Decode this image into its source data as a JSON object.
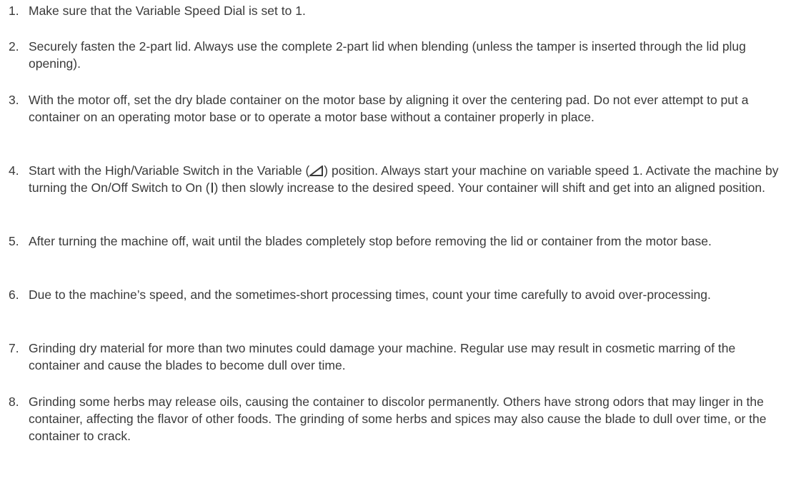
{
  "steps": [
    {
      "number": "1.",
      "text": "Make sure that the Variable Speed Dial is set to 1."
    },
    {
      "number": "2.",
      "text": "Securely fasten the 2-part lid. Always use the complete 2-part lid when blending (unless the tamper is inserted through the lid plug opening)."
    },
    {
      "number": "3.",
      "text": "With the motor off, set the dry blade container on the motor base by aligning it over the centering pad. Do not ever attempt to put a container on an operating motor base or to operate a motor base without a container properly in place."
    },
    {
      "number": "4.",
      "text_before_variable_symbol": "Start with the High/Variable Switch in the Variable (",
      "text_after_variable_symbol": ") position. Always start your machine on variable speed 1. Activate the machine by turning the On/Off Switch to On (",
      "text_after_on_symbol": ") then slowly increase to the desired speed. Your container will shift and get into an aligned position.",
      "variable_symbol_icon": "variable-speed-ramp-icon",
      "on_symbol_icon": "on-bar-icon"
    },
    {
      "number": "5.",
      "text": "After turning the machine off, wait until the blades completely stop before removing the lid or container from the motor base."
    },
    {
      "number": "6.",
      "text": "Due to the machine’s speed, and the sometimes-short processing times, count your time carefully to avoid over-processing."
    },
    {
      "number": "7.",
      "text": "Grinding dry material for more than two minutes could damage your machine. Regular use may result in cosmetic marring of the container and cause the blades to become dull over time."
    },
    {
      "number": "8.",
      "text": "Grinding some herbs may release oils, causing the container to discolor permanently. Others have strong odors that may linger in the container, affecting the flavor of other foods. The grinding of some herbs and spices may also cause the blade to dull over time, or the container to crack."
    }
  ],
  "colors": {
    "text": "#3a3a3a",
    "background": "#ffffff"
  }
}
